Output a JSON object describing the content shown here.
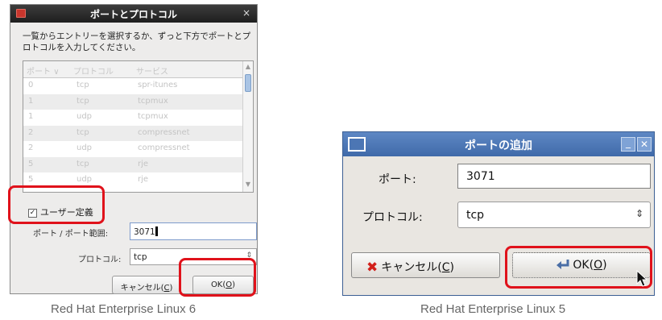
{
  "rhel6": {
    "title": "ポートとプロトコル",
    "close_glyph": "×",
    "description": "一覧からエントリーを選択するか、ずっと下方でポートとプロトコルを入力してください。",
    "columns": [
      "ポート",
      "プロトコル",
      "サービス"
    ],
    "sort_glyph": "∨",
    "rows": [
      {
        "port": "0",
        "protocol": "tcp",
        "service": "spr-itunes"
      },
      {
        "port": "1",
        "protocol": "tcp",
        "service": "tcpmux"
      },
      {
        "port": "1",
        "protocol": "udp",
        "service": "tcpmux"
      },
      {
        "port": "2",
        "protocol": "tcp",
        "service": "compressnet"
      },
      {
        "port": "2",
        "protocol": "udp",
        "service": "compressnet"
      },
      {
        "port": "5",
        "protocol": "tcp",
        "service": "rje"
      },
      {
        "port": "5",
        "protocol": "udp",
        "service": "rje"
      }
    ],
    "custom_checkbox_label": "ユーザー定義",
    "custom_checked": true,
    "port_label": "ポート / ポート範囲:",
    "port_value": "3071",
    "protocol_label": "プロトコル:",
    "protocol_value": "tcp",
    "cancel_label_prefix": "キャンセル(",
    "cancel_mnemonic": "C",
    "cancel_label_suffix": ")",
    "ok_label_prefix": "OK(",
    "ok_mnemonic": "O",
    "ok_label_suffix": ")",
    "caption": "Red Hat Enterprise Linux 6"
  },
  "rhel5": {
    "title": "ポートの追加",
    "port_label": "ポート:",
    "port_value": "3071",
    "protocol_label": "プロトコル:",
    "protocol_value": "tcp",
    "cancel_label_prefix": "キャンセル(",
    "cancel_mnemonic": "C",
    "cancel_label_suffix": ")",
    "ok_label_prefix": "OK(",
    "ok_mnemonic": "O",
    "ok_label_suffix": ")",
    "caption": "Red Hat Enterprise Linux 5"
  },
  "colors": {
    "highlight": "#e0121b",
    "rhel5_titlebar": "#4f7bb9",
    "rhel6_titlebar": "#2a2a2a"
  }
}
